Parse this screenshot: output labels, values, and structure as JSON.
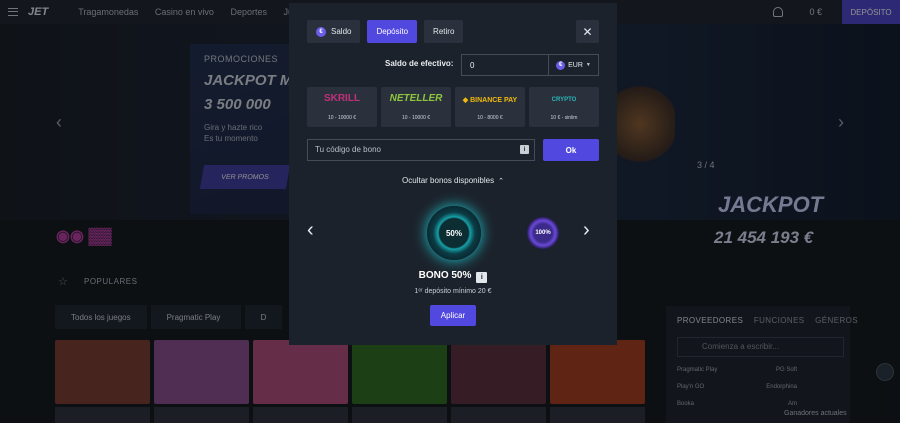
{
  "header": {
    "logo": "JET",
    "nav": [
      "Tragamonedas",
      "Casino en vivo",
      "Deportes",
      "Ju"
    ],
    "balance": "0 €",
    "deposit_btn": "DEPÓSITO"
  },
  "hero": {
    "promo_label": "PROMOCIONES",
    "jackpot_title": "JACKPOT M",
    "jackpot_amount": "3 500 000",
    "subtitle_1": "Gira y hazte rico",
    "subtitle_2": "Es tu momento",
    "cta": "VER PROMOS",
    "pager": "3 / 4",
    "side_jackpot": "JACKPOT",
    "side_amount": "21 454 193 €"
  },
  "lobby": {
    "section": "POPULARES",
    "tabs": [
      "Todos los juegos",
      "Pragmatic Play",
      "D"
    ],
    "tile_colors": [
      "#7a3a2a",
      "#8a4a8a",
      "#b34a7a",
      "#2c6a1c",
      "#5a2a3a",
      "#a83a1a"
    ],
    "providers_tabs": [
      "PROVEEDORES",
      "FUNCIONES",
      "GÉNEROS"
    ],
    "providers_search": "Comienza a escribir...",
    "providers": [
      [
        "Pragmatic Play",
        "PG Soft"
      ],
      [
        "Play'n GO",
        "Endorphina"
      ],
      [
        "Booka",
        "Am"
      ]
    ],
    "winners": "Ganadores actuales"
  },
  "modal": {
    "tabs": [
      {
        "label": "Saldo",
        "active": false,
        "coin": true
      },
      {
        "label": "Depósito",
        "active": true,
        "coin": false
      },
      {
        "label": "Retiro",
        "active": false,
        "coin": false
      }
    ],
    "close": "✕",
    "cash_label": "Saldo de efectivo:",
    "cash_value": "0",
    "currency": "EUR",
    "methods": [
      {
        "name": "SKRILL",
        "range": "10 - 10000 €",
        "color": "#c0307a"
      },
      {
        "name": "NETELLER",
        "range": "10 - 10000 €",
        "color": "#8ec63f"
      },
      {
        "name": "◆ BINANCE PAY",
        "range": "10 - 8000 €",
        "color": "#f0b90b"
      },
      {
        "name": "CRYPTO",
        "range": "10 € - sinlim",
        "color": "#2ab6b8"
      }
    ],
    "bonus_placeholder": "Tu código de bono",
    "ok": "Ok",
    "hide_bonus": "Ocultar bonos disponibles",
    "bonus_badge_big": "50%",
    "bonus_badge_small": "100%",
    "bonus_title": "BONO 50%",
    "bonus_min": "1ᵉʳ depósito mínimo 20 €",
    "apply": "Aplicar"
  }
}
